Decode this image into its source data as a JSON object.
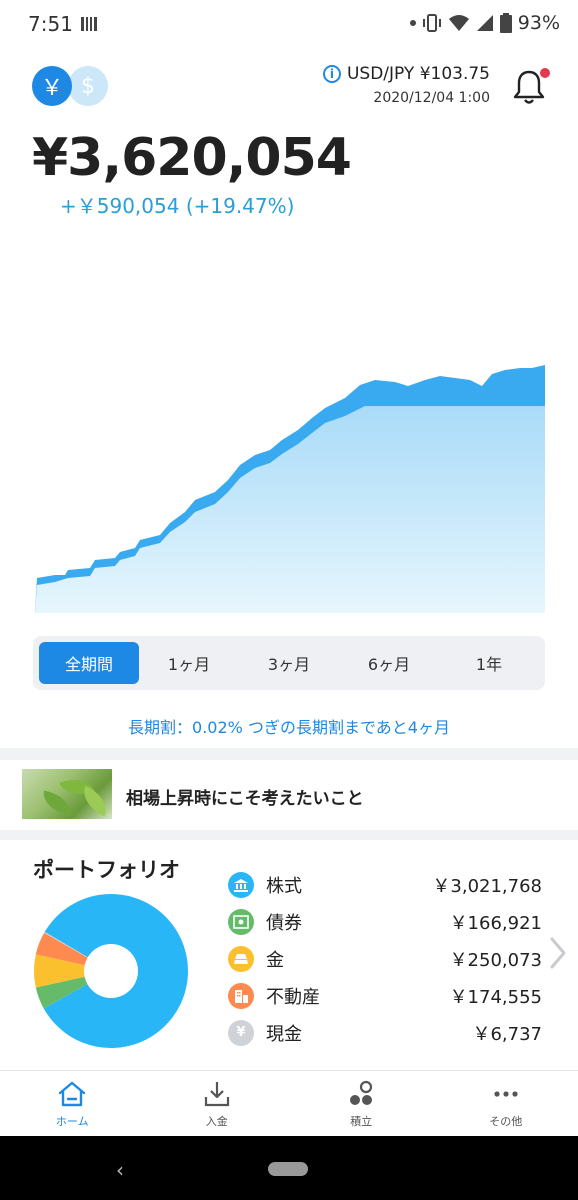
{
  "status_bar": {
    "time": "7:51",
    "battery": "93%"
  },
  "header": {
    "fx_label": "USD/JPY ¥103.75",
    "fx_datetime": "2020/12/04 1:00",
    "total_assets": "¥3,620,054",
    "gain": "+￥590,054 (+19.47%)",
    "currency_yen_symbol": "￥",
    "currency_usd_symbol": "$"
  },
  "colors": {
    "accent": "#1e88e5",
    "stocks": "#29b6f6",
    "bonds": "#66bb6a",
    "gold": "#fbc02d",
    "real_estate": "#ff8a50",
    "cash": "#cfd2d6"
  },
  "period_tabs": [
    {
      "label": "全期間",
      "active": true
    },
    {
      "label": "1ヶ月",
      "active": false
    },
    {
      "label": "3ヶ月",
      "active": false
    },
    {
      "label": "6ヶ月",
      "active": false
    },
    {
      "label": "1年",
      "active": false
    }
  ],
  "long_term_discount": "長期割：0.02% つぎの長期割まであと4ヶ月",
  "article": {
    "title": "相場上昇時にこそ考えたいこと"
  },
  "portfolio": {
    "title": "ポートフォリオ",
    "assets": [
      {
        "name": "株式",
        "value": "￥3,021,768",
        "icon": "bank-icon",
        "amount": 3021768
      },
      {
        "name": "債券",
        "value": "￥166,921",
        "icon": "bond-certificate-icon",
        "amount": 166921
      },
      {
        "name": "金",
        "value": "￥250,073",
        "icon": "gold-bars-icon",
        "amount": 250073
      },
      {
        "name": "不動産",
        "value": "￥174,555",
        "icon": "building-icon",
        "amount": 174555
      },
      {
        "name": "現金",
        "value": "￥6,737",
        "icon": "cash-icon",
        "amount": 6737
      }
    ]
  },
  "bottom_nav": [
    {
      "label": "ホーム",
      "icon": "home-icon",
      "active": true
    },
    {
      "label": "入金",
      "icon": "deposit-icon",
      "active": false
    },
    {
      "label": "積立",
      "icon": "accumulate-icon",
      "active": false
    },
    {
      "label": "その他",
      "icon": "more-icon",
      "active": false
    }
  ]
}
